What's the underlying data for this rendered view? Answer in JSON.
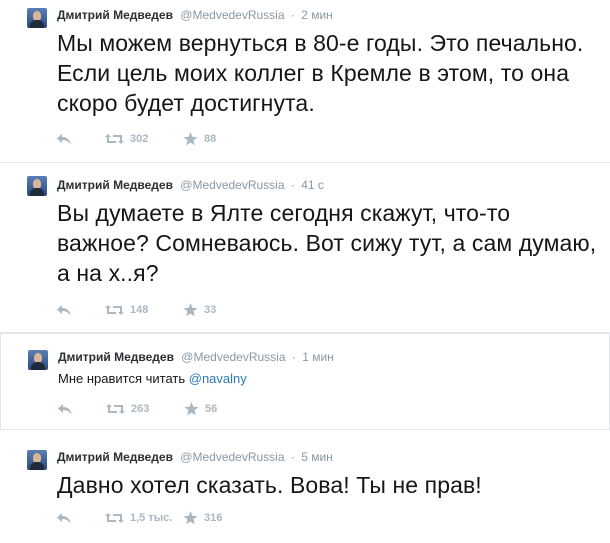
{
  "tweets": [
    {
      "fullname": "Дмитрий Медведев",
      "username": "@MedvedevRussia",
      "time": "2 мин",
      "text": "Мы можем вернуться в 80-е годы. Это печально. Если цель моих коллег в Кремле в этом, то она скоро будет достигнута.",
      "retweets": "302",
      "favorites": "88"
    },
    {
      "fullname": "Дмитрий Медведев",
      "username": "@MedvedevRussia",
      "time": "41 с",
      "text": "Вы думаете в Ялте сегодня скажут, что-то важное? Сомневаюсь. Вот сижу тут, а сам думаю, а на х..я?",
      "retweets": "148",
      "favorites": "33"
    },
    {
      "fullname": "Дмитрий Медведев",
      "username": "@MedvedevRussia",
      "time": "1 мин",
      "text_prefix": "Мне нравится читать ",
      "mention": "@navalny",
      "retweets": "263",
      "favorites": "56"
    },
    {
      "fullname": "Дмитрий Медведев",
      "username": "@MedvedevRussia",
      "time": "5 мин",
      "text": "Давно хотел сказать. Вова! Ты не прав!",
      "retweets": "1,5 тыс.",
      "favorites": "316"
    }
  ],
  "icons": {
    "reply": "reply-arrow-icon",
    "retweet": "retweet-icon",
    "favorite": "star-icon"
  },
  "colors": {
    "link": "#2b7bb9",
    "meta": "#8899a6",
    "action": "#aab8c2",
    "border": "#e1e8ed"
  }
}
